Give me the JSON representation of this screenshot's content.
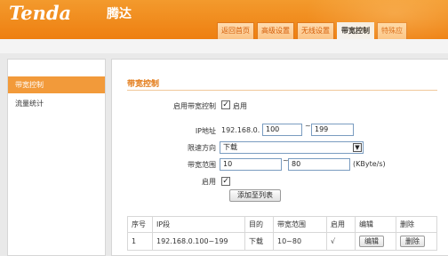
{
  "brand": {
    "logo": "Tenda",
    "logo_cn": "腾达"
  },
  "nav": {
    "tabs": [
      {
        "label": "返回首页"
      },
      {
        "label": "高级设置"
      },
      {
        "label": "无线设置"
      },
      {
        "label": "带宽控制"
      },
      {
        "label": "特殊应"
      }
    ]
  },
  "sidebar": {
    "items": [
      {
        "label": "带宽控制"
      },
      {
        "label": "流量统计"
      }
    ]
  },
  "main": {
    "title": "带宽控制",
    "enable": {
      "label": "启用带宽控制",
      "checkbox_text": "启用",
      "checked": true
    },
    "ip": {
      "label": "IP地址",
      "prefix": "192.168.0.",
      "start": "100",
      "separator": "~",
      "end": "199"
    },
    "direction": {
      "label": "限速方向",
      "value": "下载"
    },
    "range": {
      "label": "带宽范围",
      "min": "10",
      "separator": "~",
      "max": "80",
      "unit": "(KByte/s)"
    },
    "enabled": {
      "label": "启用",
      "checked": true
    },
    "add_button": "添加至列表"
  },
  "table": {
    "headers": [
      "序号",
      "IP段",
      "目的",
      "带宽范围",
      "启用",
      "编辑",
      "删除"
    ],
    "rows": [
      {
        "index": "1",
        "ip_range": "192.168.0.100~199",
        "direction": "下载",
        "bandwidth": "10~80",
        "enabled": "√",
        "edit": "编辑",
        "delete": "删除"
      }
    ]
  },
  "colors": {
    "accent": "#ee7f10",
    "title": "#e27711",
    "sidebar_active": "#f29a3a"
  }
}
